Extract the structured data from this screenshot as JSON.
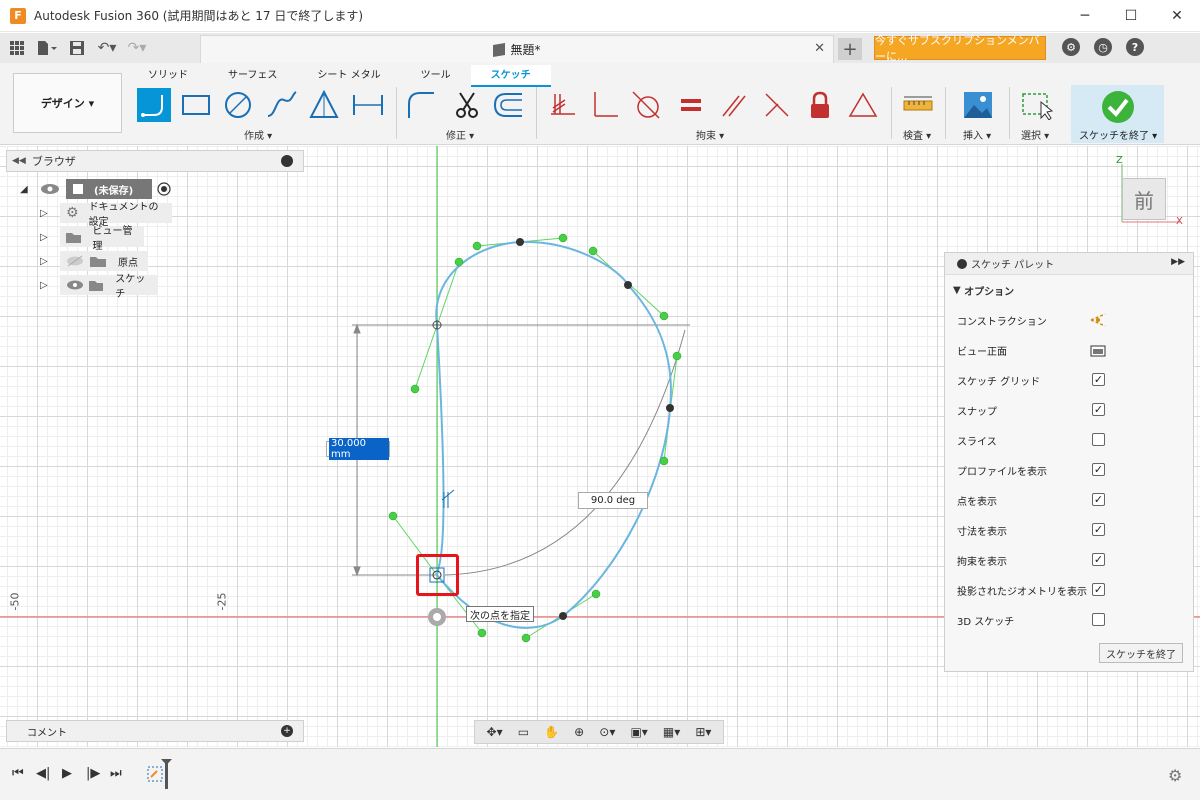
{
  "window": {
    "title": "Autodesk Fusion 360 (試用期間はあと 17 日で終了します)",
    "logo": "F"
  },
  "toolbar": {
    "doc_tab": "無題*",
    "subscribe_label": "今すぐサブスクリプションメンバーに..."
  },
  "ribbon": {
    "workspace": "デザイン ▾",
    "tabs": [
      "ソリッド",
      "サーフェス",
      "シート メタル",
      "ツール",
      "スケッチ"
    ],
    "groups": {
      "create": "作成 ▾",
      "modify": "修正 ▾",
      "constraints": "拘束 ▾",
      "inspect": "検査 ▾",
      "insert": "挿入 ▾",
      "select": "選択 ▾",
      "finish": "スケッチを終了 ▾"
    }
  },
  "browser": {
    "title": "ブラウザ",
    "root": "(未保存)",
    "items": [
      "ドキュメントの設定",
      "ビュー管理",
      "原点",
      "スケッチ"
    ]
  },
  "palette": {
    "title": "スケッチ パレット",
    "section": "オプション",
    "rows": [
      {
        "label": "コンストラクション",
        "kind": "icon",
        "icon": "construction-icon"
      },
      {
        "label": "ビュー正面",
        "kind": "icon",
        "icon": "look-at-icon"
      },
      {
        "label": "スケッチ グリッド",
        "kind": "check",
        "checked": true
      },
      {
        "label": "スナップ",
        "kind": "check",
        "checked": true
      },
      {
        "label": "スライス",
        "kind": "check",
        "checked": false
      },
      {
        "label": "プロファイルを表示",
        "kind": "check",
        "checked": true
      },
      {
        "label": "点を表示",
        "kind": "check",
        "checked": true
      },
      {
        "label": "寸法を表示",
        "kind": "check",
        "checked": true
      },
      {
        "label": "拘束を表示",
        "kind": "check",
        "checked": true
      },
      {
        "label": "投影されたジオメトリを表示",
        "kind": "check",
        "checked": true
      },
      {
        "label": "3D スケッチ",
        "kind": "check",
        "checked": false
      }
    ],
    "finish": "スケッチを終了"
  },
  "comments": {
    "title": "コメント"
  },
  "viewcube": {
    "face": "前",
    "axis_z": "Z",
    "axis_x": "X"
  },
  "canvas": {
    "dimension_value": "30.000 mm",
    "angle_value": "90.0 deg",
    "tooltip": "次の点を指定",
    "axis_labels": [
      "-50",
      "-25"
    ]
  },
  "colors": {
    "accent": "#0696d7",
    "spline": "#6bb6e0",
    "handle": "#33cc33",
    "highlight": "#e8141b",
    "finish_green": "#3cb43c"
  }
}
